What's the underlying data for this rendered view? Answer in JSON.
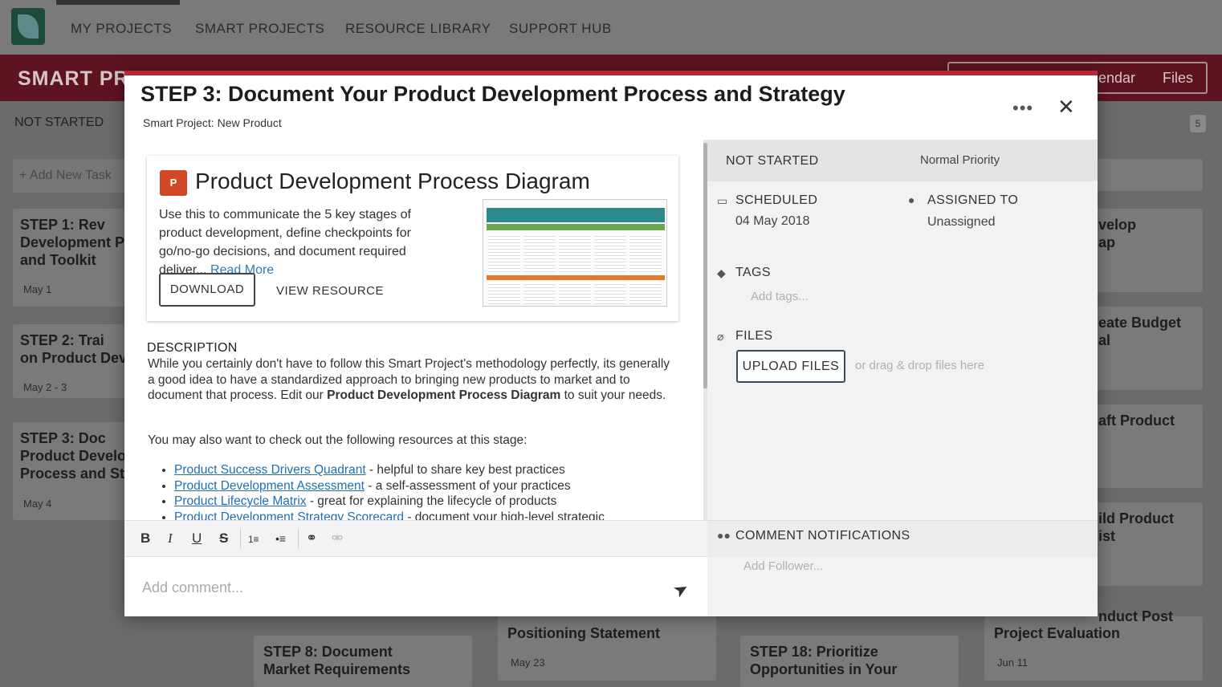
{
  "topnav": {
    "items": [
      "MY PROJECTS",
      "SMART PROJECTS",
      "RESOURCE LIBRARY",
      "SUPPORT HUB"
    ]
  },
  "project_bar": {
    "title": "SMART PR",
    "tabs": [
      "lendar",
      "Files"
    ]
  },
  "board": {
    "column_head": "NOT STARTED",
    "count": "5",
    "add_task": "+ Add New Task",
    "cards": [
      {
        "title": "STEP 1: Rev\nDevelopment P\nand Toolkit",
        "date": "May 1"
      },
      {
        "title": "STEP 2: Trai\non Product Dev",
        "date": "May 2 - 3"
      },
      {
        "title": "STEP 3: Doc\nProduct Develo\nProcess and St",
        "date": "May 4"
      },
      {
        "title": "STEP 8: Document\nMarket Requirements",
        "date": ""
      },
      {
        "title": "Positioning Statement",
        "date": "May 23"
      },
      {
        "title": "STEP 18: Prioritize\nOpportunities in Your",
        "date": ""
      },
      {
        "title": "Project Evaluation",
        "date": "Jun 11"
      }
    ],
    "right_cards": [
      {
        "title": "velop\nap"
      },
      {
        "title": "eate Budget\nal"
      },
      {
        "title": "aft Product"
      },
      {
        "title": "ild Product\nist"
      },
      {
        "title": "nduct Post"
      }
    ]
  },
  "modal": {
    "title": "STEP 3: Document Your Product Development Process and Strategy",
    "subtitle": "Smart Project: New Product",
    "more": "•••",
    "close": "✕",
    "resource": {
      "icon": "P",
      "title": "Product Development Process Diagram",
      "description": "Use this to communicate the 5 key stages of product development, define checkpoints for go/no-go decisions, and document required deliver...",
      "read_more": "Read More",
      "download": "DOWNLOAD",
      "view": "VIEW RESOURCE"
    },
    "description": {
      "heading": "DESCRIPTION",
      "body_a": "While you certainly don't have to follow this Smart Project's methodology perfectly, its generally a good idea to have a standardized approach to bringing new products to market and to document that process.  Edit our ",
      "body_bold": "Product Development Process Diagram",
      "body_b": " to suit your needs.",
      "body2": "You may also want to check out the following resources at this stage:",
      "links": [
        {
          "link": "Product Success Drivers Quadrant",
          "text": " - helpful to share key best practices"
        },
        {
          "link": "Product Development Assessment",
          "text": " - a self-assessment of your practices"
        },
        {
          "link": "Product Lifecycle Matrix",
          "text": " - great for explaining the lifecycle of products"
        },
        {
          "link": "Product Development Strategy Scorecard",
          "text": " - document your high-level strategic"
        }
      ]
    },
    "toolbar": {
      "bold": "B",
      "italic": "I",
      "underline": "U",
      "strike": "S",
      "ol": "1≡",
      "ul": "•≡",
      "link": "⚭",
      "unlink": "⚮"
    },
    "comment": {
      "placeholder": "Add comment...",
      "send": "➤"
    },
    "side": {
      "status": "NOT STARTED",
      "priority": "Normal Priority",
      "scheduled_label": "SCHEDULED",
      "scheduled_value": "04 May 2018",
      "assigned_label": "ASSIGNED TO",
      "assigned_value": "Unassigned",
      "tags_label": "TAGS",
      "tags_placeholder": "Add tags...",
      "files_label": "FILES",
      "upload": "UPLOAD FILES",
      "drop_hint": "or drag & drop files here",
      "notif_label": "COMMENT NOTIFICATIONS",
      "follower_placeholder": "Add Follower..."
    }
  }
}
